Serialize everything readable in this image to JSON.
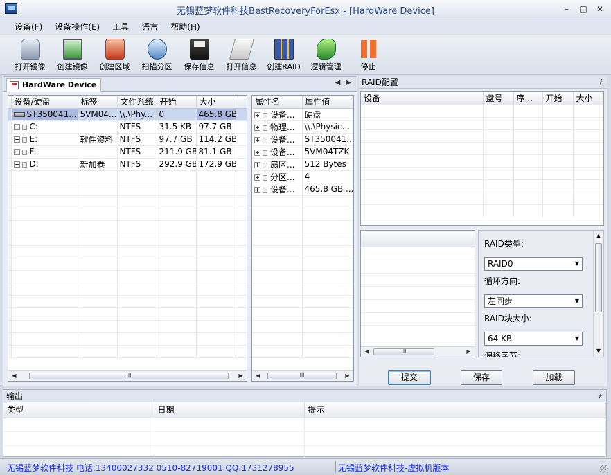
{
  "window": {
    "title": "无锡蓝梦软件科技BestRecoveryForEsx - [HardWare Device]",
    "controls": [
      "–",
      "□",
      "✕"
    ]
  },
  "menu": [
    "设备(F)",
    "设备操作(E)",
    "工具",
    "语言",
    "帮助(H)"
  ],
  "toolbar": [
    {
      "label": "打开镜像",
      "icon": "disk-image-icon",
      "cls": "ic-disk"
    },
    {
      "label": "创建镜像",
      "icon": "monitor-icon",
      "cls": "ic-monitor"
    },
    {
      "label": "创建区域",
      "icon": "area-icon",
      "cls": "ic-area"
    },
    {
      "label": "扫描分区",
      "icon": "scan-icon",
      "cls": "ic-scan"
    },
    {
      "label": "保存信息",
      "icon": "floppy-save-icon",
      "cls": "ic-save"
    },
    {
      "label": "打开信息",
      "icon": "open-file-icon",
      "cls": "ic-open"
    },
    {
      "label": "创建RAID",
      "icon": "raid-icon",
      "cls": "ic-raid"
    },
    {
      "label": "逻辑管理",
      "icon": "logic-manage-icon",
      "cls": "ic-logic"
    },
    {
      "label": "停止",
      "icon": "stop-icon",
      "cls": "ic-stop"
    }
  ],
  "device_tab": {
    "label": "HardWare Device"
  },
  "device_table": {
    "columns": [
      "设备/硬盘",
      "标签",
      "文件系统",
      "开始",
      "大小"
    ],
    "rows": [
      {
        "name": "ST350041...",
        "label": "5VM04...",
        "fs": "\\\\.\\Phy...",
        "start": "0",
        "size": "465.8 GB"
      },
      {
        "name": "C:",
        "label": "",
        "fs": "NTFS",
        "start": "31.5 KB",
        "size": "97.7 GB"
      },
      {
        "name": "E:",
        "label": "软件资料",
        "fs": "NTFS",
        "start": "97.7 GB",
        "size": "114.2 GB"
      },
      {
        "name": "F:",
        "label": "",
        "fs": "NTFS",
        "start": "211.9 GB",
        "size": "81.1 GB"
      },
      {
        "name": "D:",
        "label": "新加卷",
        "fs": "NTFS",
        "start": "292.9 GB",
        "size": "172.9 GB"
      }
    ]
  },
  "property_table": {
    "columns": [
      "属性名",
      "属性值"
    ],
    "rows": [
      {
        "name": "设备...",
        "value": "硬盘"
      },
      {
        "name": "物理...",
        "value": "\\\\.\\Physic..."
      },
      {
        "name": "设备...",
        "value": "ST350041..."
      },
      {
        "name": "设备...",
        "value": "5VM04TZK"
      },
      {
        "name": "扇区...",
        "value": "512 Bytes"
      },
      {
        "name": "分区...",
        "value": "4"
      },
      {
        "name": "设备...",
        "value": "465.8 GB ..."
      }
    ]
  },
  "scroll_grip": "III",
  "raid": {
    "header": "RAID配置",
    "pin": "📌",
    "columns": [
      "设备",
      "盘号",
      "序...",
      "开始",
      "大小"
    ],
    "type_label": "RAID类型:",
    "type_value": "RAID0",
    "direction_label": "循环方向:",
    "direction_value": "左同步",
    "blocksize_label": "RAID块大小:",
    "blocksize_value": "64 KB",
    "offset_label": "偏移字节:",
    "submit_label": "提交",
    "save_label": "保存",
    "load_label": "加载"
  },
  "output": {
    "header": "输出",
    "columns": [
      "类型",
      "日期",
      "提示"
    ]
  },
  "status": {
    "left": "无锡蓝梦软件科技 电话:13400027332 0510-82719001 QQ:1731278955",
    "right": "无锡蓝梦软件科技-虚拟机版本"
  }
}
